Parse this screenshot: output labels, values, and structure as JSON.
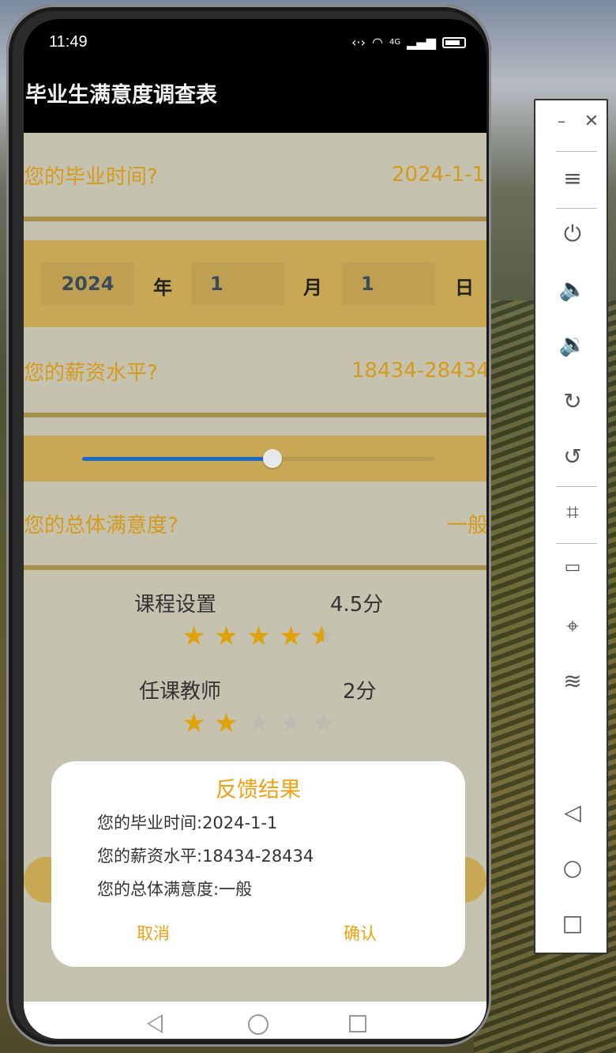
{
  "status": {
    "time": "11:49",
    "network": "4G"
  },
  "app": {
    "title": "毕业生满意度调查表"
  },
  "graduation": {
    "question": "您的毕业时间?",
    "value": "2024-1-1",
    "year": "2024",
    "year_unit": "年",
    "month": "1",
    "month_unit": "月",
    "day": "1",
    "day_unit": "日"
  },
  "salary": {
    "question": "您的薪资水平?",
    "value": "18434-28434",
    "slider_fraction": 0.54
  },
  "satisfaction": {
    "question": "您的总体满意度?",
    "value": "一般"
  },
  "ratings": [
    {
      "name": "课程设置",
      "score": "4.5分",
      "stars": 4.5
    },
    {
      "name": "任课教师",
      "score": "2分",
      "stars": 2
    }
  ],
  "dialog": {
    "title": "反馈结果",
    "line1": "您的毕业时间:2024-1-1",
    "line2": "您的薪资水平:18434-28434",
    "line3": "您的总体满意度:一般",
    "cancel": "取消",
    "confirm": "确认"
  },
  "colors": {
    "accent": "#d69a1a",
    "panel": "#c8a855",
    "background": "#c5c2b0",
    "star": "#e0a20a",
    "slider": "#1a6ac8"
  },
  "toolbar_icons": [
    "minimize-icon",
    "close-icon",
    "menu-icon",
    "power-icon",
    "volume-up-icon",
    "volume-down-icon",
    "rotate-right-icon",
    "rotate-left-icon",
    "crop-icon",
    "battery-icon",
    "location-icon",
    "wifi-icon",
    "back-icon",
    "home-icon",
    "recents-icon"
  ]
}
